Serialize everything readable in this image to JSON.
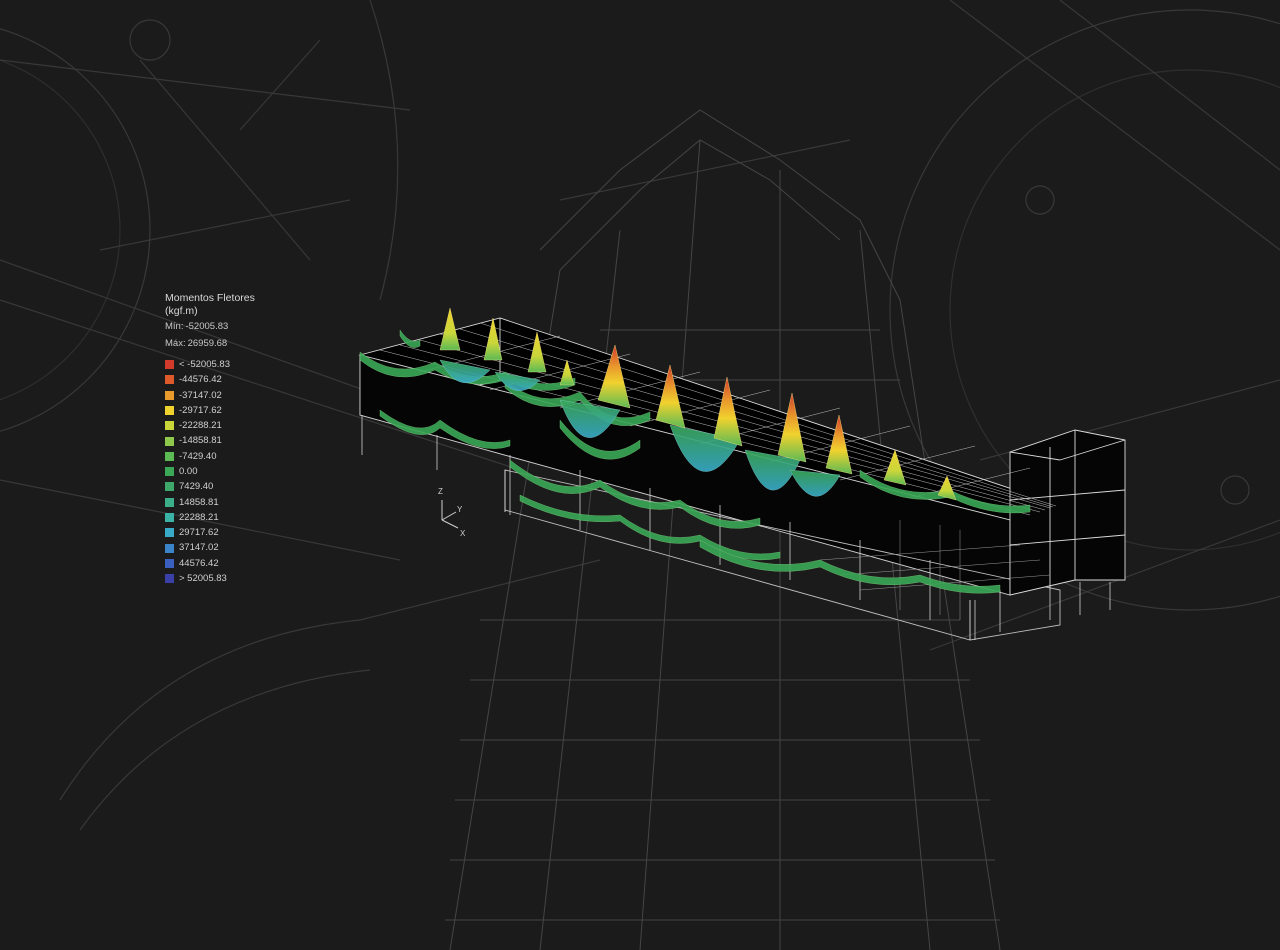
{
  "legend": {
    "title": "Momentos Fletores",
    "unit": "(kgf.m)",
    "min_label": "Mín:",
    "min_value": "-52005.83",
    "max_label": "Máx:",
    "max_value": "26959.68",
    "items": [
      {
        "label": "< -52005.83",
        "color": "#d23a2c"
      },
      {
        "label": "-44576.42",
        "color": "#df5a2a"
      },
      {
        "label": "-37147.02",
        "color": "#e99a2c"
      },
      {
        "label": "-29717.62",
        "color": "#f0d22e"
      },
      {
        "label": "-22288.21",
        "color": "#c9d63a"
      },
      {
        "label": "-14858.81",
        "color": "#8fc84a"
      },
      {
        "label": "-7429.40",
        "color": "#5cba55"
      },
      {
        "label": "0.00",
        "color": "#3aa857"
      },
      {
        "label": "7429.40",
        "color": "#3da86a"
      },
      {
        "label": "14858.81",
        "color": "#3caf8a"
      },
      {
        "label": "22288.21",
        "color": "#3ab3a6"
      },
      {
        "label": "29717.62",
        "color": "#39a9c8"
      },
      {
        "label": "37147.02",
        "color": "#3a84c9"
      },
      {
        "label": "44576.42",
        "color": "#3a5fbf"
      },
      {
        "label": "> 52005.83",
        "color": "#3a40a8"
      }
    ]
  },
  "axes": {
    "z": "Z",
    "y": "Y",
    "x": "X"
  },
  "colors": {
    "background": "#1b1b1b",
    "blueprint_line": "#3a3a3a",
    "structure_line": "#e6e6e6",
    "moment_fill": "#3aa857",
    "peak_top": "#d23a2c",
    "peak_mid": "#f0d22e",
    "sag_fill": "#39a9c8"
  }
}
